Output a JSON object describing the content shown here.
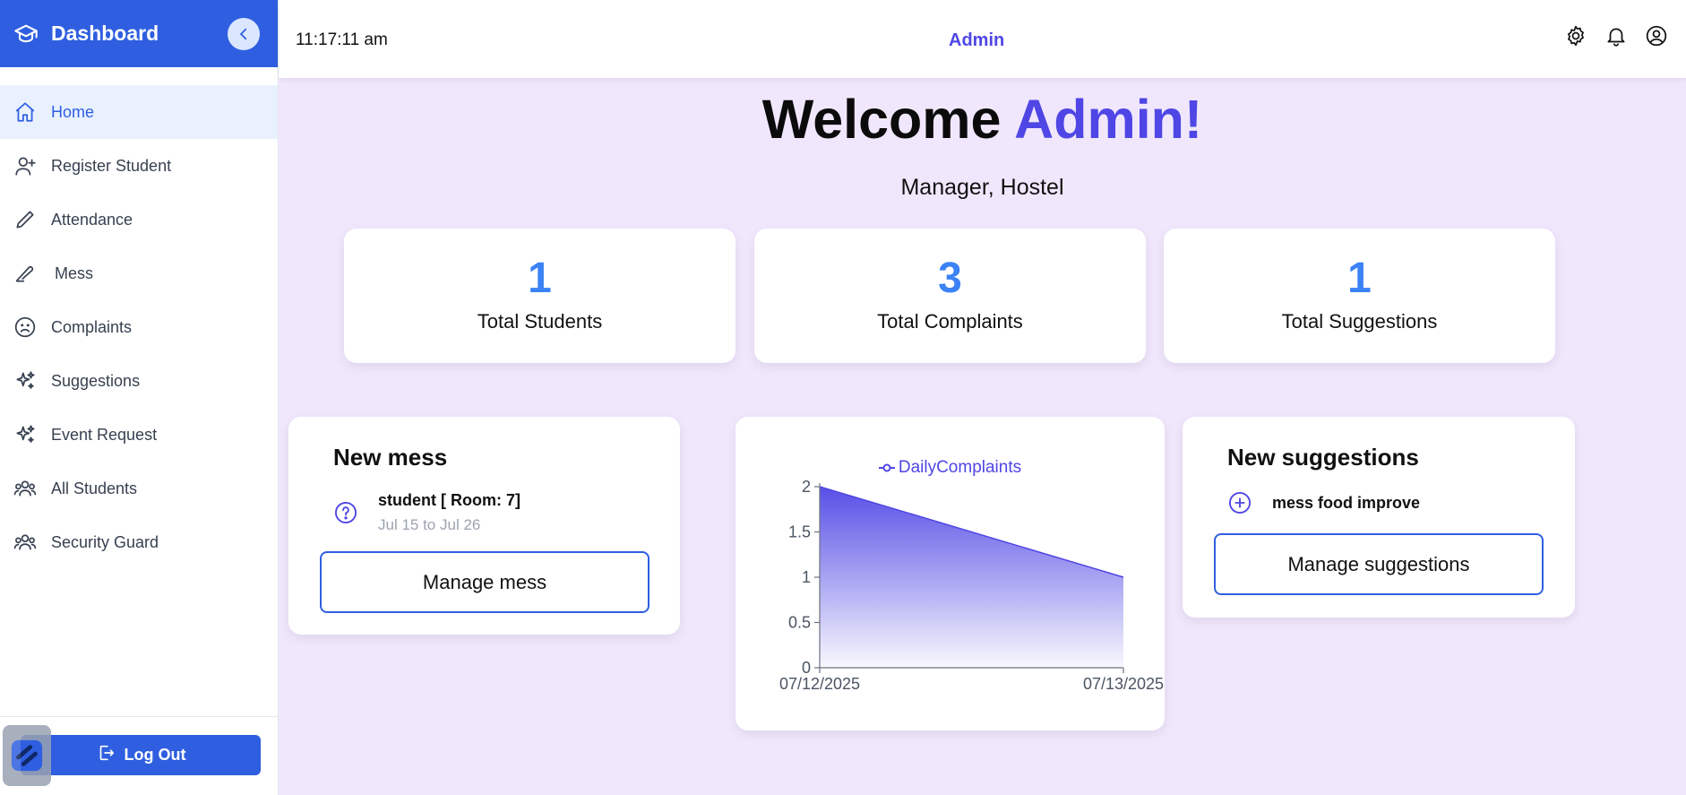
{
  "sidebar": {
    "title": "Dashboard",
    "items": [
      {
        "label": "Home",
        "icon": "home-icon"
      },
      {
        "label": "Register Student",
        "icon": "user-plus-icon"
      },
      {
        "label": "Attendance",
        "icon": "pencil-icon"
      },
      {
        "label": "Mess",
        "icon": "knife-icon"
      },
      {
        "label": "Complaints",
        "icon": "frown-icon"
      },
      {
        "label": "Suggestions",
        "icon": "sparkles-icon"
      },
      {
        "label": "Event Request",
        "icon": "sparkles-icon"
      },
      {
        "label": "All Students",
        "icon": "users-icon"
      },
      {
        "label": "Security Guard",
        "icon": "users-icon"
      }
    ],
    "logout_label": "Log Out"
  },
  "topbar": {
    "clock": "11:17:11 am",
    "role": "Admin"
  },
  "main": {
    "welcome_prefix": "Welcome ",
    "welcome_name": "Admin!",
    "subtitle": "Manager, Hostel",
    "stats": [
      {
        "value": "1",
        "label": "Total Students"
      },
      {
        "value": "3",
        "label": "Total Complaints"
      },
      {
        "value": "1",
        "label": "Total Suggestions"
      }
    ],
    "mess_card": {
      "title": "New mess",
      "entry_title": "student [ Room: 7]",
      "entry_dates": "Jul 15 to Jul 26",
      "button": "Manage mess"
    },
    "suggestions_card": {
      "title": "New suggestions",
      "entry": "mess food improve",
      "button": "Manage suggestions"
    }
  },
  "colors": {
    "primary": "#2f5fe0",
    "accent": "#4f46e5",
    "stat_number": "#3b82f6",
    "background": "#f1e7fd"
  },
  "chart_data": {
    "type": "area",
    "x": [
      "07/12/2025",
      "07/13/2025"
    ],
    "series": [
      {
        "name": "DailyComplaints",
        "values": [
          2,
          1
        ]
      }
    ],
    "yticks": [
      "0",
      "0.5",
      "1",
      "1.5",
      "2"
    ],
    "ylim": [
      0,
      2
    ],
    "legend": "top-center",
    "grid": false
  }
}
